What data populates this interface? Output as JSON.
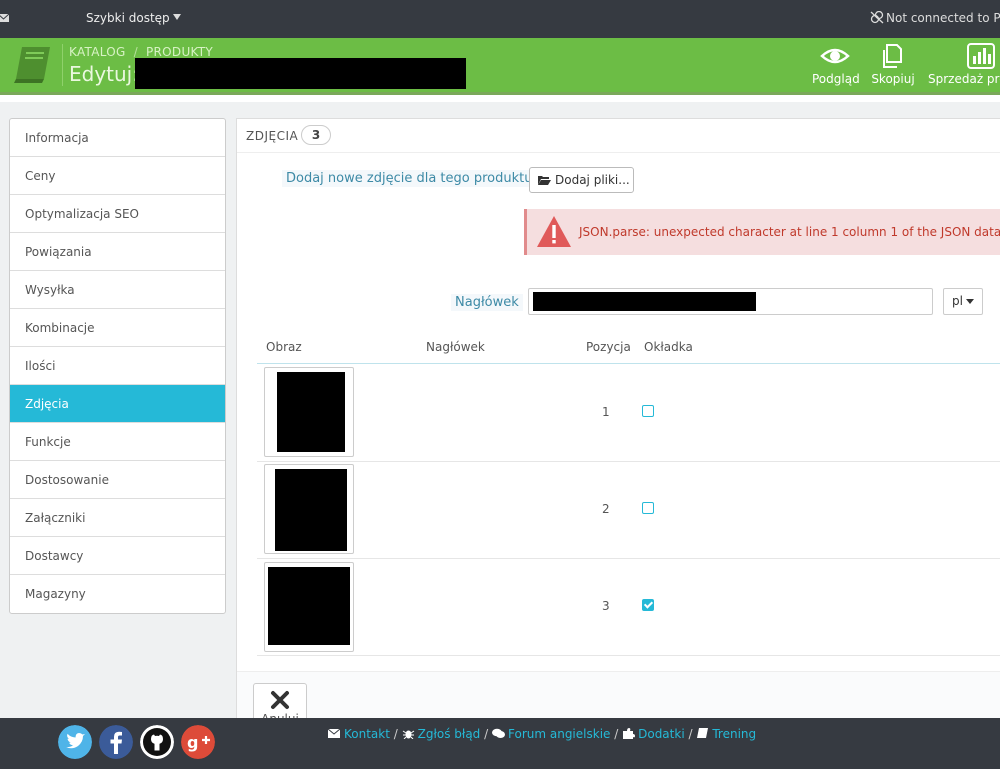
{
  "topbar": {
    "quick_access": "Szybki dostęp",
    "connection_status": "Not connected to Pre"
  },
  "header": {
    "breadcrumb_1": "KATALOG",
    "breadcrumb_2": "PRODUKTY",
    "edit_label": "Edytuj:",
    "toolbar": {
      "preview": "Podgląd",
      "copy": "Skopiuj",
      "sales": "Sprzedaż pro"
    }
  },
  "sidebar": {
    "items": [
      {
        "label": "Informacja"
      },
      {
        "label": "Ceny"
      },
      {
        "label": "Optymalizacja SEO"
      },
      {
        "label": "Powiązania"
      },
      {
        "label": "Wysyłka"
      },
      {
        "label": "Kombinacje"
      },
      {
        "label": "Ilości"
      },
      {
        "label": "Zdjęcia"
      },
      {
        "label": "Funkcje"
      },
      {
        "label": "Dostosowanie"
      },
      {
        "label": "Załączniki"
      },
      {
        "label": "Dostawcy"
      },
      {
        "label": "Magazyny"
      }
    ],
    "active_index": 7
  },
  "images_panel": {
    "title": "ZDJĘCIA",
    "count": "3",
    "add_label": "Dodaj nowe zdjęcie dla tego produktu",
    "add_button": "Dodaj pliki...",
    "error_message": "JSON.parse: unexpected character at line 1 column 1 of the JSON data",
    "caption_label": "Nagłówek",
    "language": "pl",
    "table": {
      "columns": [
        "Obraz",
        "Nagłówek",
        "Pozycja",
        "Okładka"
      ],
      "rows": [
        {
          "position": "1",
          "cover": false
        },
        {
          "position": "2",
          "cover": false
        },
        {
          "position": "3",
          "cover": true
        }
      ]
    },
    "cancel_button": "Anuluj"
  },
  "footer": {
    "links": {
      "contact": "Kontakt",
      "bug": "Zgłoś błąd",
      "forum": "Forum angielskie",
      "addons": "Dodatki",
      "training": "Trening"
    },
    "separator": "/"
  },
  "colors": {
    "header_green": "#6cbd45",
    "topbar_dark": "#363a41",
    "accent_blue": "#25b9d7",
    "error_red": "#e05a5a"
  },
  "icons": {
    "social": [
      "twitter-icon",
      "facebook-icon",
      "github-icon",
      "google-plus-icon"
    ]
  }
}
